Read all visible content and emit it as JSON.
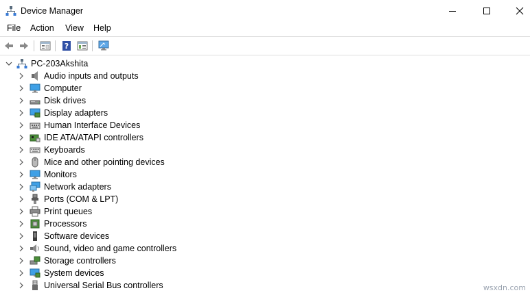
{
  "window": {
    "title": "Device Manager"
  },
  "menu": {
    "file": "File",
    "action": "Action",
    "view": "View",
    "help": "Help"
  },
  "toolbar": {
    "icons": [
      "back-arrow-icon",
      "forward-arrow-icon",
      "properties-icon",
      "help-icon",
      "view-pane-icon",
      "monitor-scan-icon"
    ]
  },
  "tree": {
    "root": "PC-203Akshita",
    "items": [
      {
        "label": "Audio inputs and outputs",
        "icon": "speaker-icon"
      },
      {
        "label": "Computer",
        "icon": "computer-icon"
      },
      {
        "label": "Disk drives",
        "icon": "disk-drive-icon"
      },
      {
        "label": "Display adapters",
        "icon": "display-adapter-icon"
      },
      {
        "label": "Human Interface Devices",
        "icon": "hid-icon"
      },
      {
        "label": "IDE ATA/ATAPI controllers",
        "icon": "ide-controller-icon"
      },
      {
        "label": "Keyboards",
        "icon": "keyboard-icon"
      },
      {
        "label": "Mice and other pointing devices",
        "icon": "mouse-icon"
      },
      {
        "label": "Monitors",
        "icon": "monitor-icon"
      },
      {
        "label": "Network adapters",
        "icon": "network-adapter-icon"
      },
      {
        "label": "Ports (COM & LPT)",
        "icon": "port-icon"
      },
      {
        "label": "Print queues",
        "icon": "printer-icon"
      },
      {
        "label": "Processors",
        "icon": "processor-icon"
      },
      {
        "label": "Software devices",
        "icon": "software-device-icon"
      },
      {
        "label": "Sound, video and game controllers",
        "icon": "sound-controller-icon"
      },
      {
        "label": "Storage controllers",
        "icon": "storage-controller-icon"
      },
      {
        "label": "System devices",
        "icon": "system-device-icon"
      },
      {
        "label": "Universal Serial Bus controllers",
        "icon": "usb-icon"
      }
    ]
  },
  "watermark": "wsxdn.com"
}
